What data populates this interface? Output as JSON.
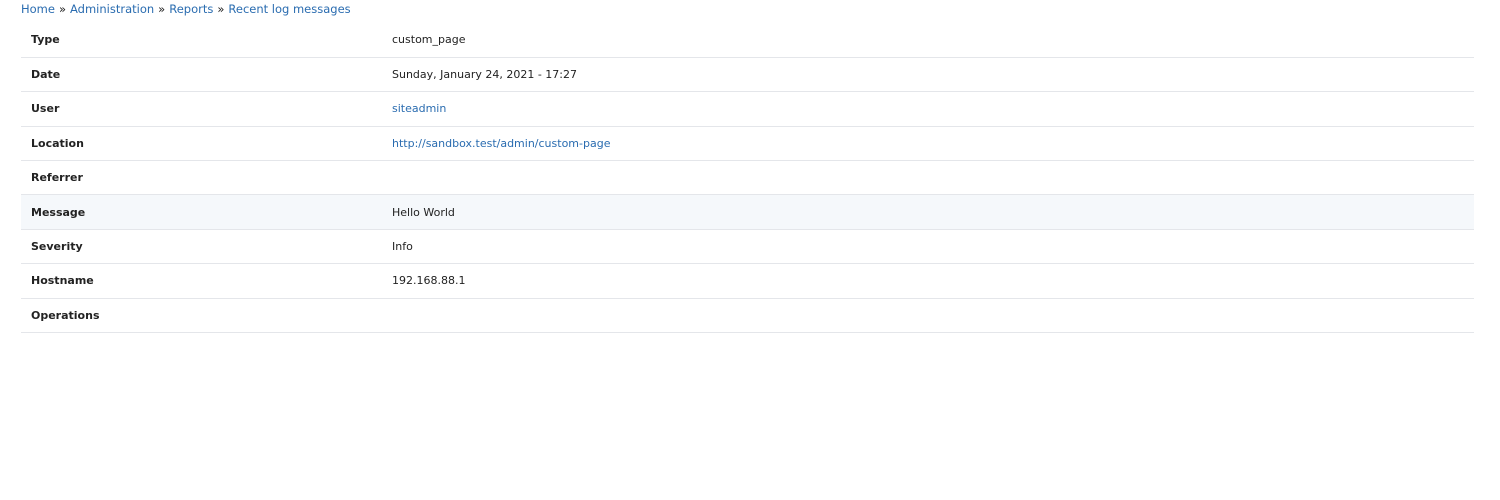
{
  "breadcrumb": {
    "items": [
      {
        "label": "Home"
      },
      {
        "label": "Administration"
      },
      {
        "label": "Reports"
      },
      {
        "label": "Recent log messages"
      }
    ],
    "separator": "»"
  },
  "details": {
    "rows": [
      {
        "label": "Type",
        "value": "custom_page"
      },
      {
        "label": "Date",
        "value": "Sunday, January 24, 2021 - 17:27"
      },
      {
        "label": "User",
        "value": "siteadmin"
      },
      {
        "label": "Location",
        "value": "http://sandbox.test/admin/custom-page"
      },
      {
        "label": "Referrer",
        "value": ""
      },
      {
        "label": "Message",
        "value": "Hello World"
      },
      {
        "label": "Severity",
        "value": "Info"
      },
      {
        "label": "Hostname",
        "value": "192.168.88.1"
      },
      {
        "label": "Operations",
        "value": ""
      }
    ]
  },
  "colors": {
    "link": "#2a6cb0",
    "row_border": "#e4e6ea",
    "row_highlight": "#f5f8fb"
  }
}
